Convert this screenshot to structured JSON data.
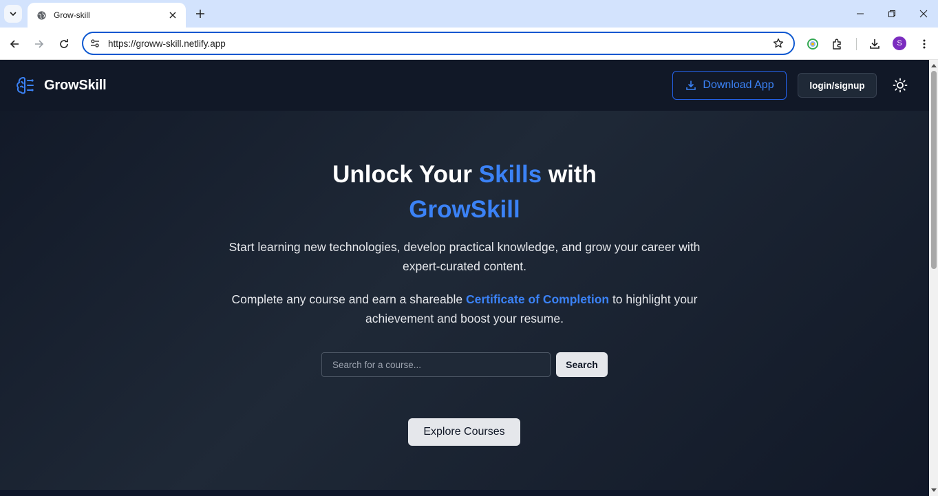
{
  "browser": {
    "tab": {
      "title": "Grow-skill"
    },
    "url": "https://groww-skill.netlify.app",
    "profile_initial": "S"
  },
  "site": {
    "brand": "GrowSkill",
    "header": {
      "download_label": "Download App",
      "login_label": "login/signup"
    },
    "hero": {
      "title_part1": "Unlock Your ",
      "title_accent1": "Skills",
      "title_part2": " with",
      "title_accent2": "GrowSkill",
      "paragraph1": "Start learning new technologies, develop practical knowledge, and grow your career with expert-curated content.",
      "paragraph2_part1": "Complete any course and earn a shareable ",
      "paragraph2_accent": "Certificate of Completion",
      "paragraph2_part2": " to highlight your achievement and boost your resume.",
      "search_placeholder": "Search for a course...",
      "search_button": "Search",
      "explore_button": "Explore Courses"
    }
  },
  "colors": {
    "accent": "#3b82f6",
    "page_background": "#111827",
    "chrome_tabstrip": "#d3e3fd"
  },
  "icons": [
    "tab-list-icon",
    "globe-icon",
    "close-icon",
    "plus-icon",
    "minimize-icon",
    "restore-icon",
    "window-close-icon",
    "back-arrow-icon",
    "forward-arrow-icon",
    "reload-icon",
    "site-settings-icon",
    "star-icon",
    "extension-color-icon",
    "puzzle-icon",
    "download-icon",
    "more-vert-icon",
    "brain-icon",
    "sun-icon"
  ]
}
